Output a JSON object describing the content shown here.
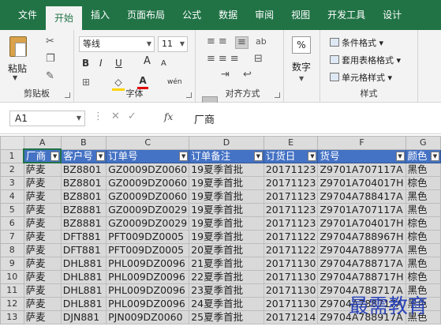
{
  "tabs": [
    "文件",
    "开始",
    "插入",
    "页面布局",
    "公式",
    "数据",
    "审阅",
    "视图",
    "开发工具",
    "设计"
  ],
  "active_tab": "开始",
  "ribbon": {
    "clipboard": {
      "paste_label": "粘贴",
      "group_label": "剪贴板"
    },
    "font": {
      "font_name": "等线",
      "font_size": "11",
      "bold": "B",
      "italic": "I",
      "underline": "U",
      "grow": "A",
      "shrink": "A",
      "group_label": "字体"
    },
    "alignment": {
      "group_label": "对齐方式"
    },
    "number": {
      "percent": "%",
      "label": "数字"
    },
    "styles": {
      "items": [
        "条件格式 ▾",
        "套用表格格式 ▾",
        "单元格样式 ▾"
      ],
      "group_label": "样式"
    }
  },
  "formula_bar": {
    "name_box": "A1",
    "fx": "fx",
    "value": "厂商"
  },
  "grid": {
    "columns": [
      "A",
      "B",
      "C",
      "D",
      "E",
      "F",
      "G"
    ],
    "headers": [
      "厂商",
      "客户号",
      "订单号",
      "订单备注",
      "订货日",
      "货号",
      "颜色"
    ],
    "rows": [
      [
        "萨麦",
        "BZ8801",
        "GZ0009DZ0060",
        "19夏季首批",
        "20171123",
        "Z9701A707117A",
        "黑色"
      ],
      [
        "萨麦",
        "BZ8801",
        "GZ0009DZ0060",
        "19夏季首批",
        "20171123",
        "Z9701A704017H",
        "棕色"
      ],
      [
        "萨麦",
        "BZ8801",
        "GZ0009DZ0060",
        "19夏季首批",
        "20171123",
        "Z9704A788417A",
        "黑色"
      ],
      [
        "萨麦",
        "BZ8881",
        "GZ0009DZ0029",
        "19夏季首批",
        "20171123",
        "Z9701A707117A",
        "黑色"
      ],
      [
        "萨麦",
        "BZ8881",
        "GZ0009DZ0029",
        "19夏季首批",
        "20171123",
        "Z9701A704017H",
        "棕色"
      ],
      [
        "萨麦",
        "DFT881",
        "PFT009DZ0005",
        "19夏季首批",
        "20171122",
        "Z9704A788967H",
        "棕色"
      ],
      [
        "萨麦",
        "DFT881",
        "PFT009DZ0005",
        "20夏季首批",
        "20171122",
        "Z9704A788977A",
        "黑色"
      ],
      [
        "萨麦",
        "DHL881",
        "PHL009DZ0096",
        "21夏季首批",
        "20171130",
        "Z9704A788717A",
        "黑色"
      ],
      [
        "萨麦",
        "DHL881",
        "PHL009DZ0096",
        "22夏季首批",
        "20171130",
        "Z9704A788717H",
        "棕色"
      ],
      [
        "萨麦",
        "DHL881",
        "PHL009DZ0096",
        "23夏季首批",
        "20171130",
        "Z9704A788717A",
        "黑色"
      ],
      [
        "萨麦",
        "DHL881",
        "PHL009DZ0096",
        "24夏季首批",
        "20171130",
        "Z9704A788717A",
        "黑色"
      ],
      [
        "萨麦",
        "DJN881",
        "PJN009DZ0060",
        "25夏季首批",
        "20171214",
        "Z9704A788917A",
        "黑色"
      ]
    ]
  },
  "watermark": "最需教育",
  "colors": {
    "tab_bar": "#217346",
    "header_fill": "#4472c4",
    "selection": "#d9d9d9"
  }
}
